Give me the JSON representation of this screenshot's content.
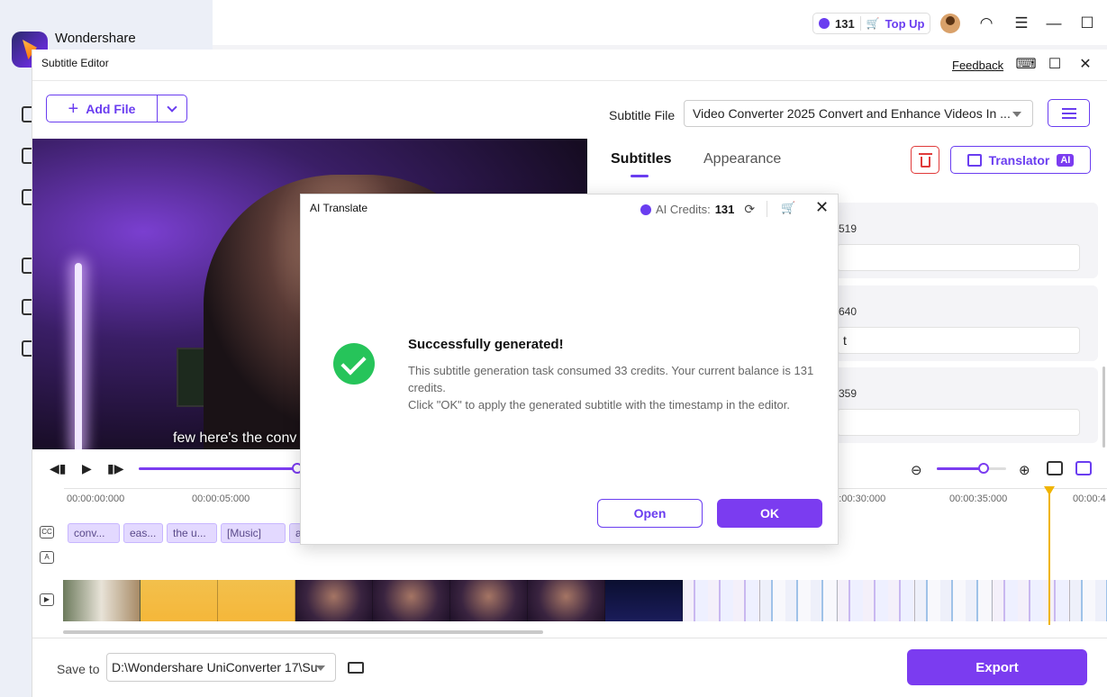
{
  "app": {
    "name": "Wondershare",
    "credits": "131",
    "top_up_label": "Top Up"
  },
  "editor": {
    "title": "Subtitle Editor",
    "feedback_label": "Feedback",
    "add_file_label": "Add File",
    "video_caption": "few here's the conv",
    "subtitle_file_label": "Subtitle File",
    "subtitle_file_value": "Video Converter 2025 Convert and Enhance Videos In ...",
    "tabs": [
      {
        "label": "Subtitles",
        "active": true
      },
      {
        "label": "Appearance",
        "active": false
      }
    ],
    "translator_label": "Translator",
    "translator_badge": "AI",
    "subtitle_cards": [
      {
        "time_fragment": "519",
        "text": ""
      },
      {
        "time_fragment": "640",
        "text": "t"
      },
      {
        "time_fragment": "359",
        "text": ""
      }
    ]
  },
  "timeline": {
    "ticks": [
      "00:00:00:000",
      "00:00:05:000",
      "00:00:30:000",
      "00:00:35:000",
      "00:00:4"
    ],
    "subtitle_chips": [
      "conv...",
      "eas...",
      "the u...",
      "[Music]",
      "a"
    ],
    "track_labels": [
      "CC",
      "A"
    ]
  },
  "footer": {
    "save_label": "Save to",
    "save_path": "D:\\Wondershare UniConverter 17\\Su",
    "export_label": "Export"
  },
  "dialog": {
    "title": "AI Translate",
    "credits_label": "AI Credits:",
    "credits_value": "131",
    "heading": "Successfully generated!",
    "message_line1": "This subtitle generation task consumed 33 credits. Your current balance is 131 credits.",
    "message_line2": "Click \"OK\" to apply the generated subtitle with the timestamp in the editor.",
    "open_label": "Open",
    "ok_label": "OK"
  },
  "colors": {
    "accent": "#7b3cf0",
    "success": "#26c45a",
    "danger": "#e03a3a",
    "playhead": "#f0b400"
  }
}
